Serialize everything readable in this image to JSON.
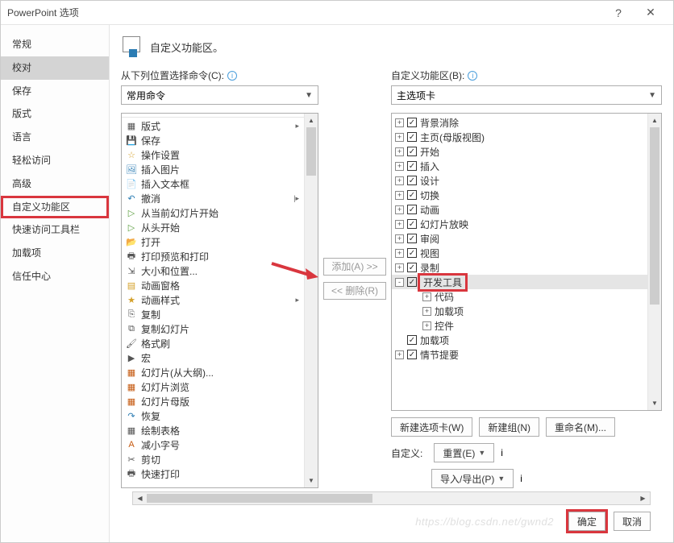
{
  "window": {
    "title": "PowerPoint 选项",
    "help": "?",
    "close": "✕"
  },
  "sidebar": {
    "items": [
      {
        "label": "常规"
      },
      {
        "label": "校对",
        "selected": true
      },
      {
        "label": "保存"
      },
      {
        "label": "版式"
      },
      {
        "label": "语言"
      },
      {
        "label": "轻松访问"
      },
      {
        "label": "高级"
      },
      {
        "label": "自定义功能区",
        "highlighted": true
      },
      {
        "label": "快速访问工具栏"
      },
      {
        "label": "加载项"
      },
      {
        "label": "信任中心"
      }
    ]
  },
  "header": {
    "title": "自定义功能区。"
  },
  "left_label": "从下列位置选择命令(C):",
  "right_label": "自定义功能区(B):",
  "left_combo": "常用命令",
  "right_combo": "主选项卡",
  "commands": [
    {
      "icon": "layout",
      "label": "版式",
      "sub": "▸",
      "sep": true
    },
    {
      "icon": "save",
      "label": "保存"
    },
    {
      "icon": "action",
      "label": "操作设置"
    },
    {
      "icon": "image",
      "label": "插入图片"
    },
    {
      "icon": "textbox",
      "label": "插入文本框"
    },
    {
      "icon": "undo",
      "label": "撤消",
      "sub": "|▸"
    },
    {
      "icon": "play",
      "label": "从当前幻灯片开始"
    },
    {
      "icon": "play-start",
      "label": "从头开始"
    },
    {
      "icon": "open",
      "label": "打开"
    },
    {
      "icon": "print",
      "label": "打印预览和打印"
    },
    {
      "icon": "resize",
      "label": "大小和位置..."
    },
    {
      "icon": "anim-pane",
      "label": "动画窗格"
    },
    {
      "icon": "anim-style",
      "label": "动画样式",
      "sub": "▸"
    },
    {
      "icon": "copy",
      "label": "复制"
    },
    {
      "icon": "dup-slide",
      "label": "复制幻灯片"
    },
    {
      "icon": "format-painter",
      "label": "格式刷"
    },
    {
      "icon": "macro",
      "label": "宏"
    },
    {
      "icon": "slides-outline",
      "label": "幻灯片(从大纲)..."
    },
    {
      "icon": "slide-sorter",
      "label": "幻灯片浏览"
    },
    {
      "icon": "slide-master",
      "label": "幻灯片母版"
    },
    {
      "icon": "redo",
      "label": "恢复"
    },
    {
      "icon": "table",
      "label": "绘制表格"
    },
    {
      "icon": "font-dec",
      "label": "减小字号"
    },
    {
      "icon": "cut",
      "label": "剪切"
    },
    {
      "icon": "quickprint",
      "label": "快速打印"
    }
  ],
  "middle": {
    "add": "添加(A) >>",
    "remove": "<< 删除(R)"
  },
  "tree": [
    {
      "exp": "+",
      "chk": true,
      "label": "背景消除"
    },
    {
      "exp": "+",
      "chk": true,
      "label": "主页(母版视图)"
    },
    {
      "exp": "+",
      "chk": true,
      "label": "开始"
    },
    {
      "exp": "+",
      "chk": true,
      "label": "插入"
    },
    {
      "exp": "+",
      "chk": true,
      "label": "设计"
    },
    {
      "exp": "+",
      "chk": true,
      "label": "切换"
    },
    {
      "exp": "+",
      "chk": true,
      "label": "动画"
    },
    {
      "exp": "+",
      "chk": true,
      "label": "幻灯片放映"
    },
    {
      "exp": "+",
      "chk": true,
      "label": "审阅"
    },
    {
      "exp": "+",
      "chk": true,
      "label": "视图"
    },
    {
      "exp": "+",
      "chk": true,
      "label": "录制"
    },
    {
      "exp": "-",
      "chk": true,
      "label": "开发工具",
      "selected": true,
      "highlighted": true
    },
    {
      "exp": "+",
      "indent": 1,
      "label": "代码"
    },
    {
      "exp": "+",
      "indent": 1,
      "label": "加载项"
    },
    {
      "exp": "+",
      "indent": 1,
      "label": "控件"
    },
    {
      "chk": true,
      "label": "加载项",
      "indent": 0,
      "noexp": true
    },
    {
      "exp": "+",
      "chk": true,
      "label": "情节提要"
    }
  ],
  "buttons": {
    "new_tab": "新建选项卡(W)",
    "new_group": "新建组(N)",
    "rename": "重命名(M)...",
    "customize_label": "自定义:",
    "reset": "重置(E)",
    "import_export": "导入/导出(P)"
  },
  "footer": {
    "ok": "确定",
    "cancel": "取消",
    "watermark": "https://blog.csdn.net/gwnd2"
  }
}
